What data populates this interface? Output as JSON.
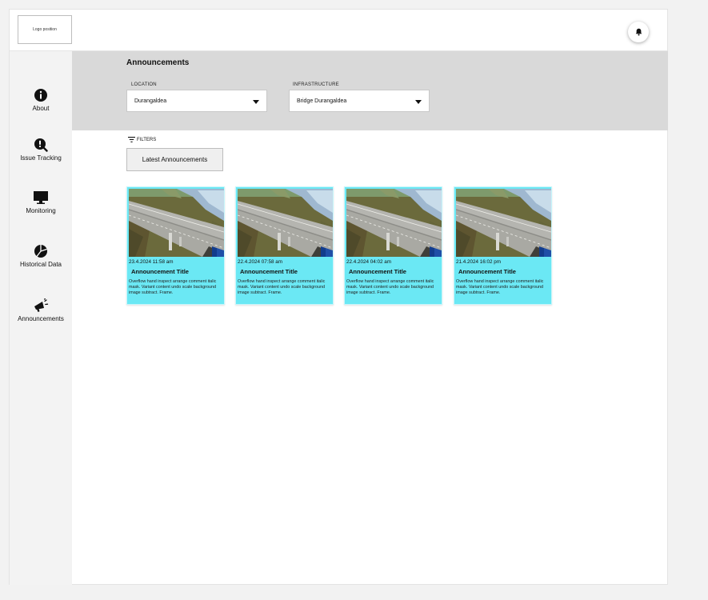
{
  "header": {
    "logo_text": "Logo position",
    "bell_icon": "bell-icon"
  },
  "sidebar": {
    "items": [
      {
        "label": "About",
        "icon": "info-icon"
      },
      {
        "label": "Issue Tracking",
        "icon": "alert-search-icon"
      },
      {
        "label": "Monitoring",
        "icon": "monitor-icon"
      },
      {
        "label": "Historical Data",
        "icon": "pie-chart-icon"
      },
      {
        "label": "Announcements",
        "icon": "megaphone-icon"
      }
    ]
  },
  "main": {
    "title": "Announcements",
    "location": {
      "label": "LOCATION",
      "value": "Durangaldea"
    },
    "infrastructure": {
      "label": "INFRASTRUCTURE",
      "value": "Bridge Durangaldea"
    },
    "filters_label": "FILTERS",
    "tab_label": "Latest Announcements",
    "cards": [
      {
        "date": "23.4.2024 11:58 am",
        "title": "Announcement Title",
        "description": "Overflow hand inspect arrange comment italic mask. Variant content undo scale background image subtract. Frame."
      },
      {
        "date": "22.4.2024 07:58 am",
        "title": "Announcement Title",
        "description": "Overflow hand inspect arrange comment italic mask. Variant content undo scale background image subtract. Frame."
      },
      {
        "date": "22.4.2024 04:02 am",
        "title": "Announcement Title",
        "description": "Overflow hand inspect arrange comment italic mask. Variant content undo scale background image subtract. Frame."
      },
      {
        "date": "21.4.2024 16:02 pm",
        "title": "Announcement Title",
        "description": "Overflow hand inspect arrange comment italic mask. Variant content undo scale background image subtract. Frame."
      }
    ]
  },
  "colors": {
    "card_bg": "#6be8f4",
    "header_band": "#d9d9d9",
    "sidebar_bg": "#f3f3f3"
  }
}
